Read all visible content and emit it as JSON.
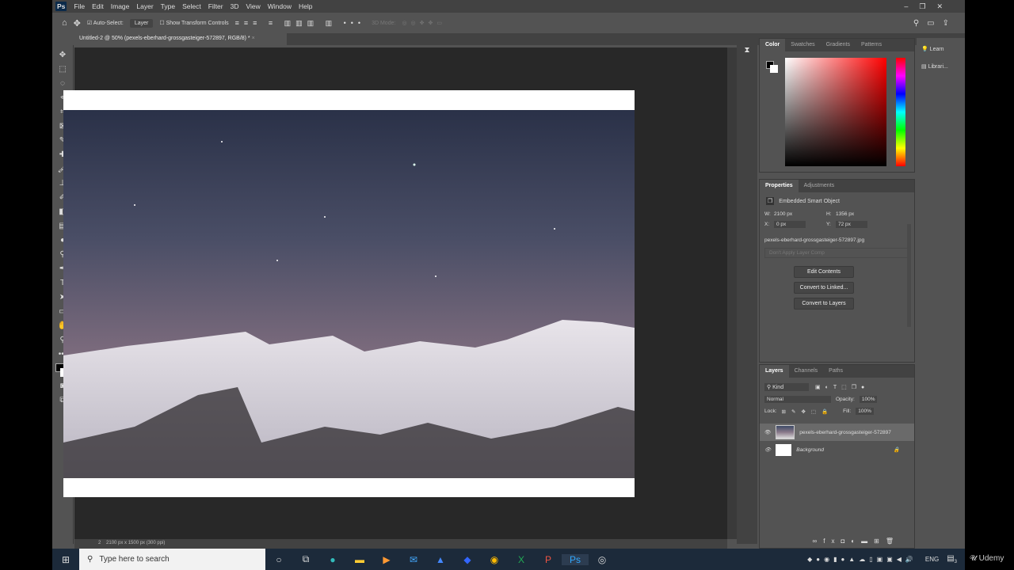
{
  "menu": {
    "logo": "Ps",
    "items": [
      "File",
      "Edit",
      "Image",
      "Layer",
      "Type",
      "Select",
      "Filter",
      "3D",
      "View",
      "Window",
      "Help"
    ]
  },
  "options": {
    "auto_select": "Auto-Select:",
    "layer_select": "Layer",
    "show_transform": "Show Transform Controls",
    "mode_3d": "3D Mode:"
  },
  "doc_tab": {
    "title": "Untitled-2 @ 50% (pexels-eberhard-grossgasteiger-572897, RGB/8) *"
  },
  "status": {
    "page": "2",
    "doc_info": "2100 px x 1500 px (300 ppi)"
  },
  "color_panel": {
    "tabs": [
      "Color",
      "Swatches",
      "Gradients",
      "Patterns"
    ]
  },
  "side_panel": {
    "learn": "Learn",
    "libraries": "Librari..."
  },
  "properties": {
    "tabs": [
      "Properties",
      "Adjustments"
    ],
    "type": "Embedded Smart Object",
    "w_label": "W:",
    "w": "2100 px",
    "h_label": "H:",
    "h": "1356 px",
    "x_label": "X:",
    "x": "0 px",
    "y_label": "Y:",
    "y": "72 px",
    "filename": "pexels-eberhard-grossgasteiger-572897.jpg",
    "layer_comp": "Don't Apply Layer Comp",
    "buttons": [
      "Edit Contents",
      "Convert to Linked...",
      "Convert to Layers"
    ]
  },
  "layers": {
    "tabs": [
      "Layers",
      "Channels",
      "Paths"
    ],
    "kind": "Kind",
    "blend": "Normal",
    "opacity_label": "Opacity:",
    "opacity": "100%",
    "lock_label": "Lock:",
    "fill_label": "Fill:",
    "fill": "100%",
    "items": [
      {
        "name": "pexels-eberhard-grossgasteiger-572897"
      },
      {
        "name": "Background"
      }
    ]
  },
  "taskbar": {
    "search_placeholder": "Type here to search",
    "lang": "ENG",
    "notif": "3"
  },
  "watermark": "Udemy"
}
